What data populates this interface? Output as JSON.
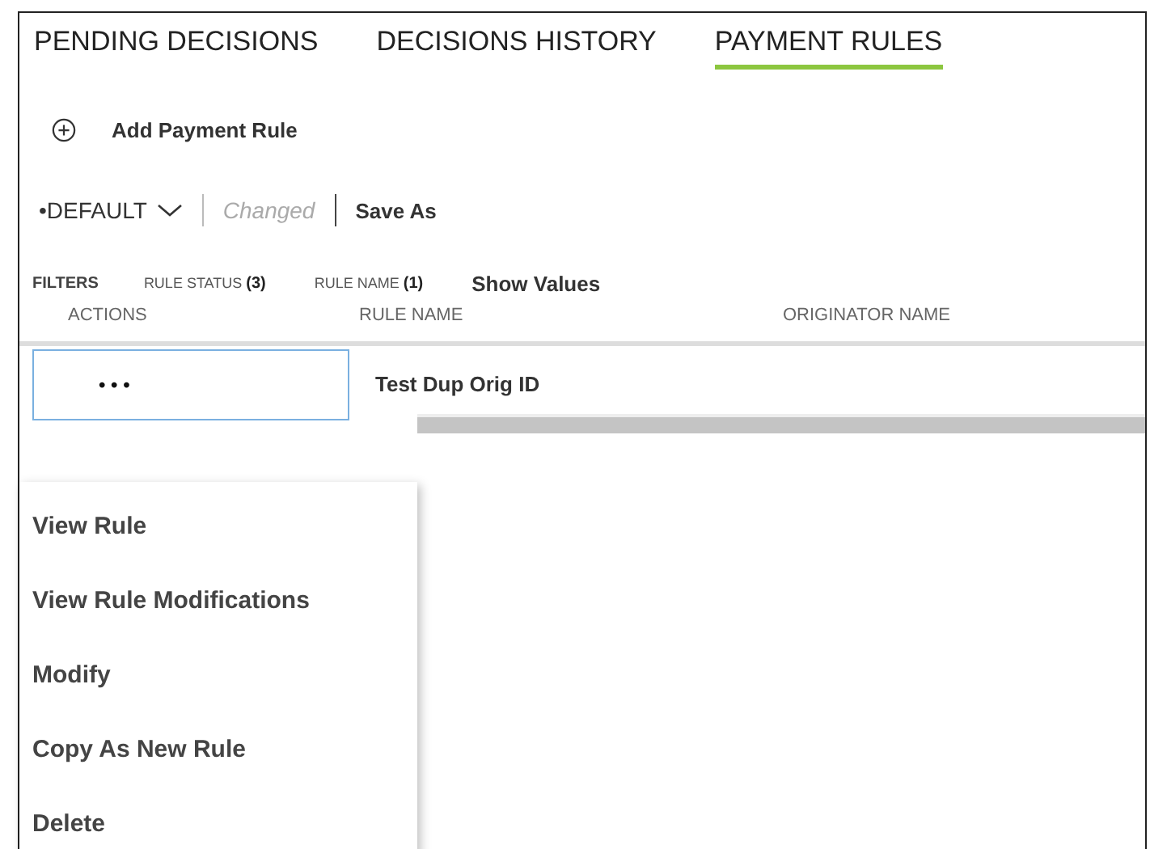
{
  "tabs": [
    {
      "label": "PENDING DECISIONS",
      "selected": false
    },
    {
      "label": "DECISIONS HISTORY",
      "selected": false
    },
    {
      "label": "PAYMENT RULES",
      "selected": true
    }
  ],
  "add_button": {
    "label": "Add Payment Rule"
  },
  "view_bar": {
    "view": "•DEFAULT",
    "status": "Changed",
    "save_as": "Save As"
  },
  "filters": {
    "label": "FILTERS",
    "items": [
      "RULE STATUS **(3)**",
      "RULE NAME **(1)**"
    ],
    "show_values": "Show Values"
  },
  "table": {
    "columns": [
      "ACTIONS",
      "RULE NAME",
      "ORIGINATOR NAME"
    ],
    "rows": [
      {
        "actions": "• • •",
        "rule_name": "Test Dup Orig ID",
        "originator_name": ""
      }
    ]
  },
  "menu": {
    "items": [
      "View Rule",
      "View Rule Modifications",
      "Modify",
      "Copy As New Rule",
      "Delete"
    ]
  }
}
